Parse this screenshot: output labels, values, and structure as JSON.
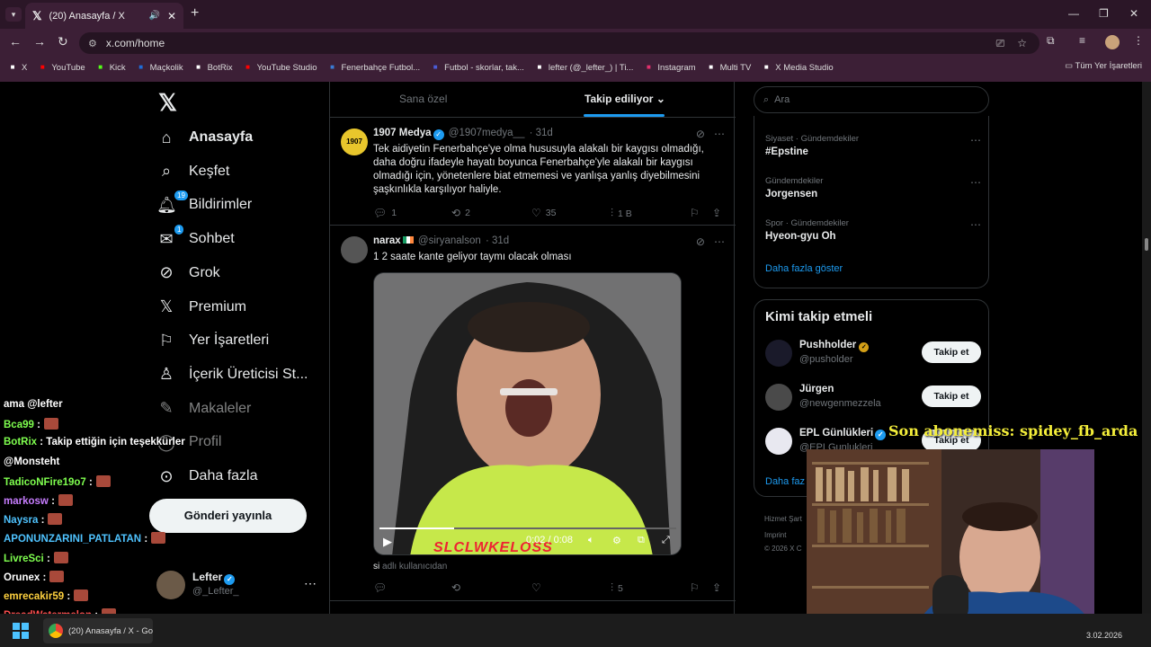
{
  "browser": {
    "tab_title": "(20) Anasayfa / X",
    "url": "x.com/home",
    "bookmarks": [
      {
        "label": "X",
        "icon": "x-icon",
        "color": "#ffffff"
      },
      {
        "label": "YouTube",
        "icon": "youtube-icon",
        "color": "#ff0000"
      },
      {
        "label": "Kick",
        "icon": "kick-icon",
        "color": "#53fc18"
      },
      {
        "label": "Maçkolik",
        "icon": "mackolik-icon",
        "color": "#1e6cd8"
      },
      {
        "label": "BotRix",
        "icon": "botrix-icon",
        "color": "#ffffff"
      },
      {
        "label": "YouTube Studio",
        "icon": "youtube-studio-icon",
        "color": "#ff0000"
      },
      {
        "label": "Fenerbahçe Futbol...",
        "icon": "fenerbahce-icon",
        "color": "#3a7bd5"
      },
      {
        "label": "Futbol - skorlar, tak...",
        "icon": "flashscore-icon",
        "color": "#4a5cd6"
      },
      {
        "label": "lefter (@_lefter_) | Ti...",
        "icon": "tiktok-icon",
        "color": "#ffffff"
      },
      {
        "label": "Instagram",
        "icon": "instagram-icon",
        "color": "#e1306c"
      },
      {
        "label": "Multi TV",
        "icon": "multitv-icon",
        "color": "#ffffff"
      },
      {
        "label": "X Media Studio",
        "icon": "x-media-studio-icon",
        "color": "#ffffff"
      }
    ],
    "all_bookmarks": "Tüm Yer İşaretleri"
  },
  "nav": {
    "items": [
      {
        "label": "Anasayfa",
        "icon": "home-icon"
      },
      {
        "label": "Keşfet",
        "icon": "search-icon"
      },
      {
        "label": "Bildirimler",
        "icon": "bell-icon",
        "badge": "19"
      },
      {
        "label": "Sohbet",
        "icon": "mail-icon",
        "badge": "1"
      },
      {
        "label": "Grok",
        "icon": "grok-icon"
      },
      {
        "label": "Premium",
        "icon": "x-icon"
      },
      {
        "label": "Yer İşaretleri",
        "icon": "bookmark-icon"
      },
      {
        "label": "İçerik Üreticisi St...",
        "icon": "creator-studio-icon"
      },
      {
        "label": "Makaleler",
        "icon": "articles-icon"
      },
      {
        "label": "Profil",
        "icon": "profile-icon"
      },
      {
        "label": "Daha fazla",
        "icon": "more-icon"
      }
    ],
    "post_button": "Gönderi yayınla",
    "me": {
      "name": "Lefter",
      "handle": "@_Lefter_"
    }
  },
  "feed": {
    "tabs": [
      "Sana özel",
      "Takip ediliyor"
    ],
    "tweets": [
      {
        "name": "1907 Medya",
        "handle": "@1907medya__",
        "time": "· 31d",
        "text": "Tek aidiyetin Fenerbahçe'ye olma hususuyla alakalı bir kaygısı olmadığı, daha doğru ifadeyle hayatı boyunca Fenerbahçe'yle alakalı bir kaygısı olmadığı için, yönetenlere biat etmemesi ve yanlışa yanlış diyebilmesini şaşkınlıkla karşılıyor haliyle.",
        "replies": "1",
        "reposts": "2",
        "likes": "35",
        "views": "1 B"
      },
      {
        "name": "narax",
        "handle": "@siryanalson",
        "time": "· 31d",
        "text": "1 2 saate kante geliyor taymı olacak olması",
        "video_time": "0:02 / 0:08",
        "video_caption": "SLCLWKELOSS",
        "source_user": "si",
        "source_suffix": "adlı kullanıcıdan",
        "replies": "",
        "reposts": "",
        "likes": "",
        "views": "5"
      }
    ]
  },
  "right": {
    "search_placeholder": "Ara",
    "trends": [
      {
        "category": "Siyaset · Gündemdekiler",
        "title": "#Epstine"
      },
      {
        "category": "Gündemdekiler",
        "title": "Jorgensen"
      },
      {
        "category": "Spor · Gündemdekiler",
        "title": "Hyeon-gyu Oh"
      }
    ],
    "show_more": "Daha fazla göster",
    "who_to_follow_title": "Kimi takip etmeli",
    "who_to_follow": [
      {
        "name": "Pushholder",
        "handle": "@pusholder",
        "button": "Takip et"
      },
      {
        "name": "Jürgen",
        "handle": "@newgenmezzela",
        "button": "Takip et"
      },
      {
        "name": "EPL Günlükleri",
        "handle": "@EPLGunlukleri",
        "button": "Takip et"
      }
    ],
    "show_more_2": "Daha faz",
    "footer_1": "Hizmet Şart",
    "footer_2": "Imprint",
    "footer_3": "© 2026 X C"
  },
  "stream": {
    "chat": [
      {
        "user": "ama @lefter",
        "msg": "",
        "color": "#ffffff"
      },
      {
        "user": "Bca99",
        "msg": ":",
        "color": "#7fff4f"
      },
      {
        "user": "BotRix",
        "msg": ": Takip ettiğin için teşekkürler",
        "color": "#7fff4f"
      },
      {
        "user": "@Monsteht",
        "msg": "",
        "color": "#ffffff"
      },
      {
        "user": "TadicoNFire19o7",
        "msg": ":",
        "color": "#7fff4f"
      },
      {
        "user": "markosw",
        "msg": ":",
        "color": "#c77dff"
      },
      {
        "user": "Naysra",
        "msg": ":",
        "color": "#4fc3ff"
      },
      {
        "user": "APONUNZARINI_PATLATAN",
        "msg": ":",
        "color": "#4fc3ff"
      },
      {
        "user": "LivreSci",
        "msg": ":",
        "color": "#7fff4f"
      },
      {
        "user": "Orunex",
        "msg": ":",
        "color": "#ffffff"
      },
      {
        "user": "emrecakir59",
        "msg": ":",
        "color": "#ffd23f"
      },
      {
        "user": "DreadWatermelon",
        "msg": ":",
        "color": "#ff4f4f"
      }
    ],
    "sub_banner": "Son abonemiss: spidey_fb_arda"
  },
  "taskbar": {
    "app_label": "(20) Anasayfa / X - Goo",
    "date": "3.02.2026"
  }
}
